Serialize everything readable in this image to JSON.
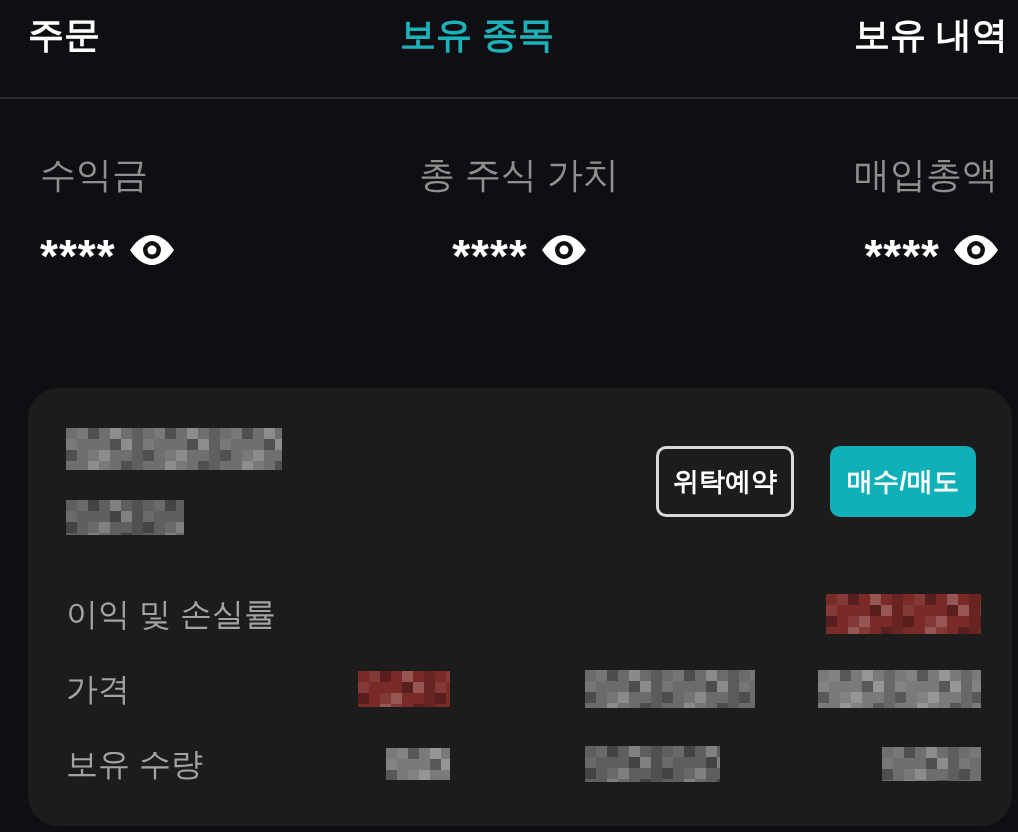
{
  "tabs": [
    {
      "label": "주문",
      "selected": false
    },
    {
      "label": "보유 종목",
      "selected": true
    },
    {
      "label": "보유 내역",
      "selected": false
    }
  ],
  "summary": [
    {
      "label": "수익금",
      "value": "****"
    },
    {
      "label": "총 주식 가치",
      "value": "****"
    },
    {
      "label": "매입총액",
      "value": "****"
    }
  ],
  "holding": {
    "name_redacted": true,
    "code_redacted": true,
    "buttons": [
      {
        "label": "위탁예약",
        "kind": "outline"
      },
      {
        "label": "매수/매도",
        "kind": "filled"
      }
    ],
    "rows": [
      {
        "label": "이익 및 손실률",
        "values": [
          {
            "color": "#7a2b27"
          }
        ]
      },
      {
        "label": "가격",
        "values": [
          {
            "color": "#7a2b27"
          },
          {
            "color": "#6b6b6b"
          },
          {
            "color": "#7a7a7a"
          }
        ]
      },
      {
        "label": "보유 수량",
        "values": [
          {
            "color": "#7a7a7a"
          },
          {
            "color": "#5e5e5e"
          },
          {
            "color": "#6e6e6e"
          }
        ]
      }
    ]
  }
}
